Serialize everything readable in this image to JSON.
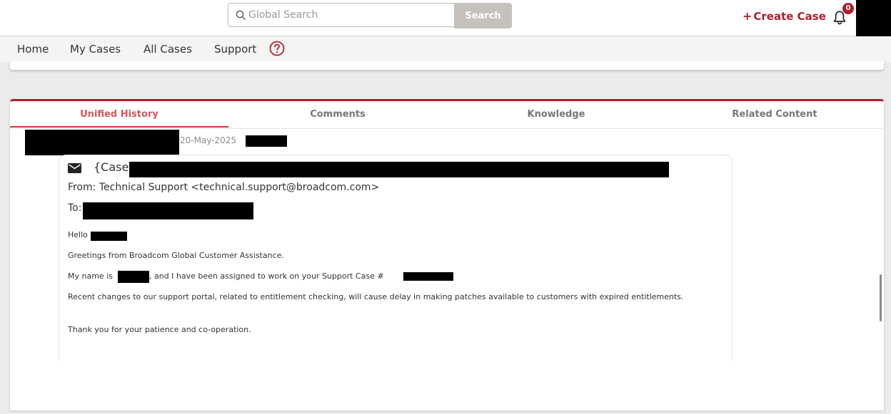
{
  "header": {
    "search": {
      "placeholder": "Global Search",
      "value": "",
      "button_label": "Search"
    },
    "create_case": {
      "plus": "+",
      "label": "Create Case"
    },
    "notifications": {
      "count": "0"
    }
  },
  "nav": {
    "items": [
      {
        "label": "Home"
      },
      {
        "label": "My Cases"
      },
      {
        "label": "All Cases"
      },
      {
        "label": "Support"
      }
    ]
  },
  "tabs": [
    {
      "label": "Unified History",
      "active": true
    },
    {
      "label": "Comments"
    },
    {
      "label": "Knowledge"
    },
    {
      "label": "Related Content"
    }
  ],
  "history_entry": {
    "date": "20-May-2025",
    "email": {
      "subject_prefix": "{Case",
      "from": "From: Technical Support <technical.support@broadcom.com>",
      "to_label": "To:",
      "greeting": "Hello",
      "body": [
        "Greetings from Broadcom Global Customer Assistance.",
        "Recent changes to our support portal, related to entitlement checking, will cause delay in making patches available to customers with expired entitlements.",
        "Thank you for your patience and co-operation."
      ],
      "assigned_prefix": "My name is",
      "assigned_suffix": ", and I have been assigned to work on your Support Case #"
    }
  },
  "colors": {
    "accent": "#b01d2e",
    "active_tab": "#d4565f",
    "search_button": "#c5c1bc",
    "nav_bg": "#f5f4f2"
  },
  "icons": [
    "search-icon",
    "bell-icon",
    "help-circle-icon",
    "envelope-icon"
  ]
}
